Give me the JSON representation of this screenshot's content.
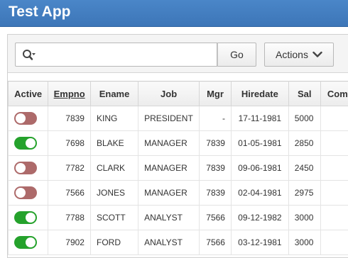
{
  "app": {
    "title": "Test App"
  },
  "toolbar": {
    "search_value": "",
    "go_label": "Go",
    "actions_label": "Actions"
  },
  "colors": {
    "header": "#4a86c8",
    "toggle_on": "#25a22c",
    "toggle_off": "#ad6a6a"
  },
  "table": {
    "columns": [
      "Active",
      "Empno",
      "Ename",
      "Job",
      "Mgr",
      "Hiredate",
      "Sal",
      "Com"
    ],
    "sorted_column": "Empno",
    "rows": [
      {
        "active": false,
        "empno": "7839",
        "ename": "KING",
        "job": "PRESIDENT",
        "mgr": "-",
        "hiredate": "17-11-1981",
        "sal": "5000"
      },
      {
        "active": true,
        "empno": "7698",
        "ename": "BLAKE",
        "job": "MANAGER",
        "mgr": "7839",
        "hiredate": "01-05-1981",
        "sal": "2850"
      },
      {
        "active": false,
        "empno": "7782",
        "ename": "CLARK",
        "job": "MANAGER",
        "mgr": "7839",
        "hiredate": "09-06-1981",
        "sal": "2450"
      },
      {
        "active": false,
        "empno": "7566",
        "ename": "JONES",
        "job": "MANAGER",
        "mgr": "7839",
        "hiredate": "02-04-1981",
        "sal": "2975"
      },
      {
        "active": true,
        "empno": "7788",
        "ename": "SCOTT",
        "job": "ANALYST",
        "mgr": "7566",
        "hiredate": "09-12-1982",
        "sal": "3000"
      },
      {
        "active": true,
        "empno": "7902",
        "ename": "FORD",
        "job": "ANALYST",
        "mgr": "7566",
        "hiredate": "03-12-1981",
        "sal": "3000"
      }
    ]
  }
}
